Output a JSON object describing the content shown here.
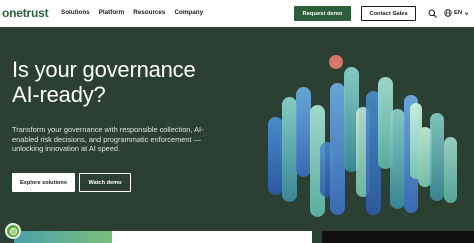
{
  "header": {
    "logo": "onetrust",
    "nav": [
      "Solutions",
      "Platform",
      "Resources",
      "Company"
    ],
    "request_demo": "Request demo",
    "contact_sales": "Contact Sales",
    "language": "EN"
  },
  "hero": {
    "title_line1": "Is your governance",
    "title_line2": "AI-ready?",
    "subtitle": "Transform your governance with responsible collection, AI-enabled risk decisions, and programmatic enforcement — unlocking innovation at AI speed.",
    "explore_label": "Explore solutions",
    "watch_label": "Watch demo"
  },
  "colors": {
    "brand_green": "#2c5e3c",
    "hero_background": "#2b3f33",
    "cookie_badge": "#5cab3a",
    "accent_dot": "#e07a6a"
  },
  "icons": {
    "search": "search-icon",
    "language": "globe-icon",
    "dropdown": "chevron-down-icon",
    "cookie": "cookie-settings-icon"
  }
}
